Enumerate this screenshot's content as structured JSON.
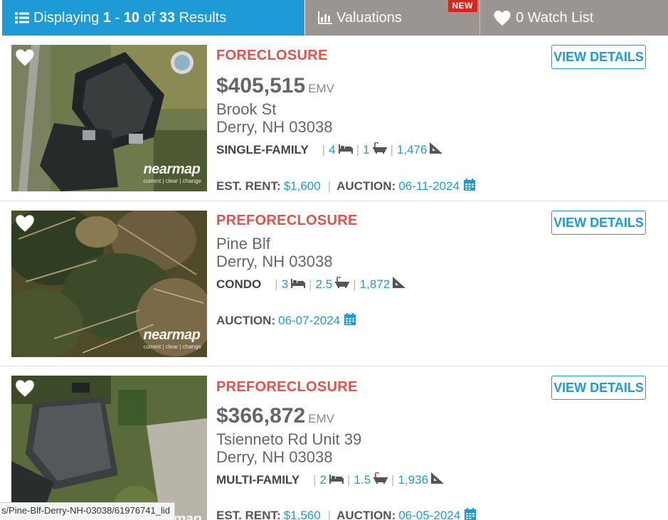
{
  "tabs": {
    "results": {
      "prefix": "Displaying ",
      "range_start": "1",
      "range_sep": " - ",
      "range_end": "10",
      "of": " of ",
      "total": "33",
      "suffix": " Results"
    },
    "valuations": {
      "label": "Valuations",
      "badge": "NEW"
    },
    "watchlist": {
      "label": "0 Watch List"
    }
  },
  "listings": [
    {
      "status": "FORECLOSURE",
      "price": "$405,515",
      "price_suffix": "EMV",
      "street": "Brook St",
      "city": "Derry, NH 03038",
      "type": "SINGLE-FAMILY",
      "beds": "4",
      "baths": "1",
      "sqft": "1,476",
      "rent_label": "EST. RENT:",
      "rent": "$1,600",
      "auction_label": "AUCTION:",
      "auction": "06-11-2024",
      "button": "VIEW DETAILS",
      "watermark": "nearmap",
      "watermark_sub": "current | clear | change"
    },
    {
      "status": "PREFORECLOSURE",
      "street": "Pine Blf",
      "city": "Derry, NH 03038",
      "type": "CONDO",
      "beds": "3",
      "baths": "2.5",
      "sqft": "1,872",
      "auction_label": "AUCTION:",
      "auction": "06-07-2024",
      "button": "VIEW DETAILS",
      "watermark": "nearmap",
      "watermark_sub": "current | clear | change"
    },
    {
      "status": "PREFORECLOSURE",
      "price": "$366,872",
      "price_suffix": "EMV",
      "street": "Tsienneto Rd Unit 39",
      "city": "Derry, NH 03038",
      "type": "MULTI-FAMILY",
      "beds": "2",
      "baths": "1.5",
      "sqft": "1,936",
      "rent_label": "EST. RENT:",
      "rent": "$1,560",
      "auction_label": "AUCTION:",
      "auction": "06-05-2024",
      "button": "VIEW DETAILS",
      "watermark": "nearmap"
    }
  ],
  "status_url": "s/Pine-Blf-Derry-NH-03038/61976741_lid",
  "icons": [
    "list-icon",
    "bar-chart-icon",
    "heart-icon",
    "bed-icon",
    "bath-icon",
    "area-icon",
    "calendar-icon"
  ],
  "colors": {
    "accent": "#1e9ad6",
    "status": "#e0524b",
    "tab_gray": "#9a9590",
    "badge": "#d9261c"
  }
}
